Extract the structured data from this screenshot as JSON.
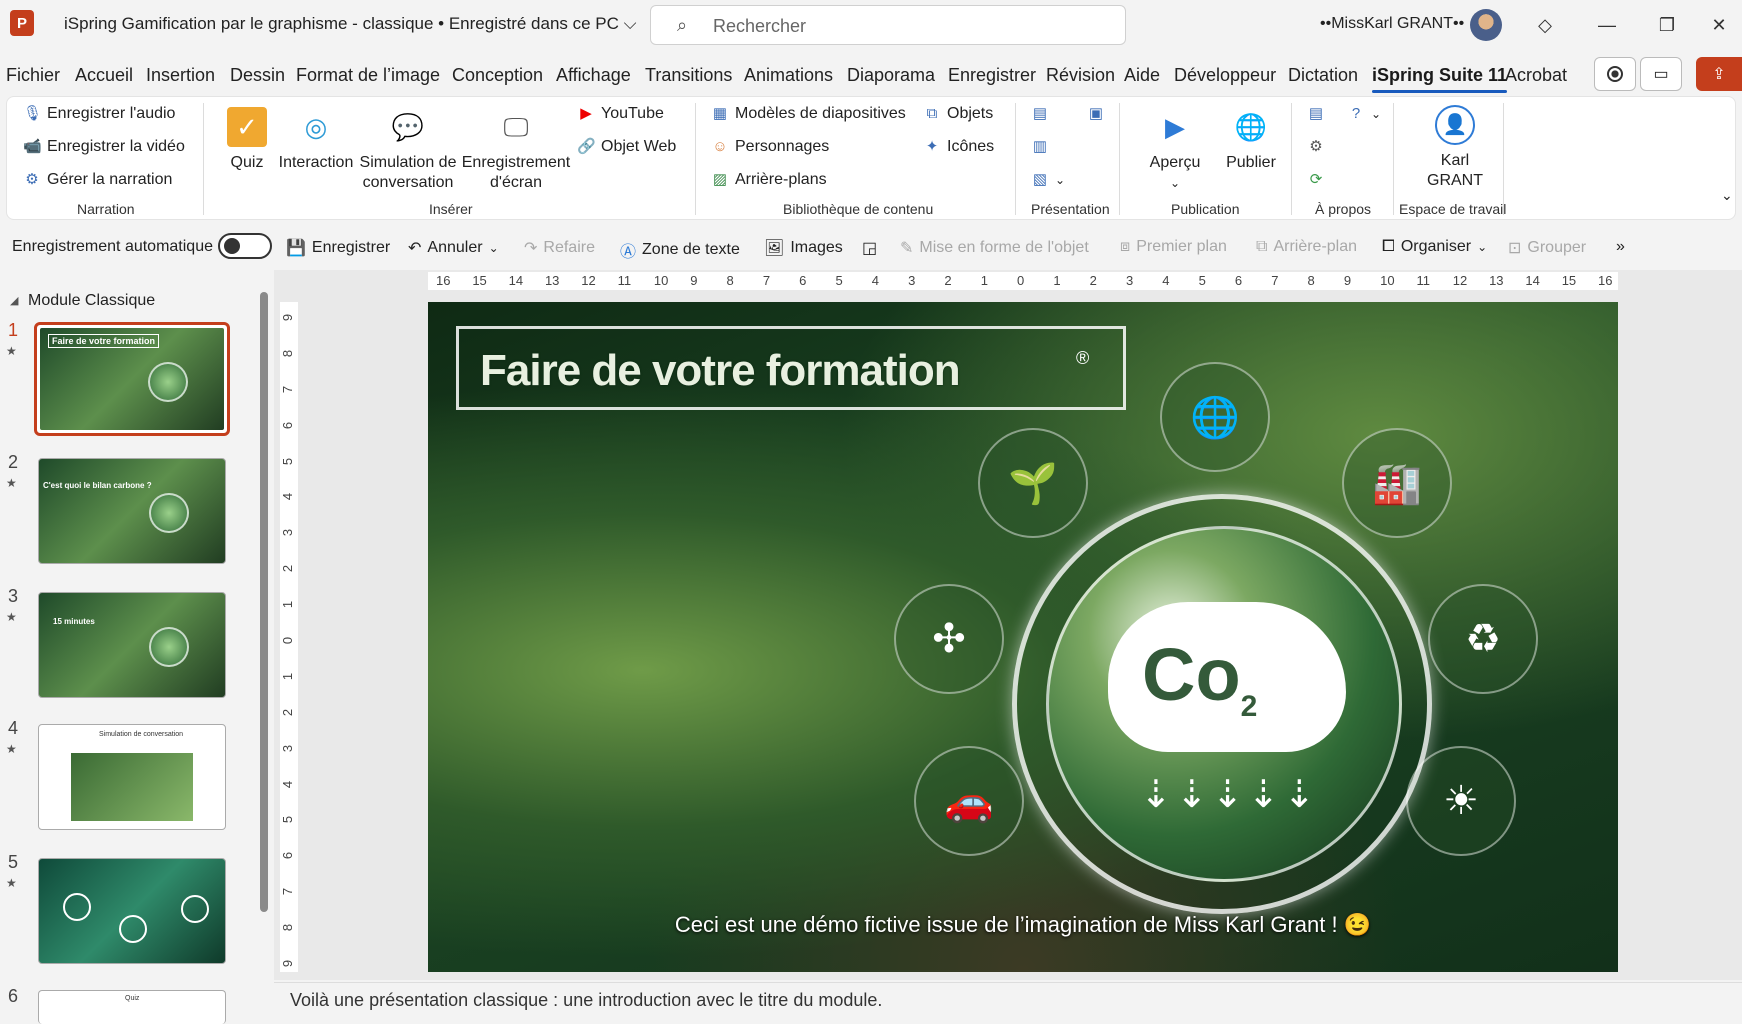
{
  "app": {
    "doc_title": "iSpring Gamification par le graphisme - classique • Enregistré dans ce PC",
    "logo_letter": "P",
    "search_placeholder": "Rechercher",
    "user_name": "••MissKarl GRANT••"
  },
  "menu": [
    "Fichier",
    "Accueil",
    "Insertion",
    "Dessin",
    "Format de l’image",
    "Conception",
    "Affichage",
    "Transitions",
    "Animations",
    "Diaporama",
    "Enregistrer",
    "Révision",
    "Aide",
    "Développeur",
    "Dictation",
    "iSpring Suite 11",
    "Acrobat"
  ],
  "active_menu": "iSpring Suite 11",
  "ribbon": {
    "narration": {
      "record_audio": "Enregistrer l'audio",
      "record_video": "Enregistrer la vidéo",
      "manage": "Gérer la narration",
      "label": "Narration"
    },
    "insert": {
      "quiz": "Quiz",
      "interaction": "Interaction",
      "simulation": "Simulation de conversation",
      "screen_rec": "Enregistrement d'écran",
      "youtube": "YouTube",
      "web_object": "Objet Web",
      "label": "Insérer"
    },
    "library": {
      "templates": "Modèles de diapositives",
      "characters": "Personnages",
      "backgrounds": "Arrière-plans",
      "objects": "Objets",
      "icons": "Icônes",
      "label": "Bibliothèque de contenu"
    },
    "presentation": {
      "label": "Présentation"
    },
    "publication": {
      "preview": "Aperçu",
      "publish": "Publier",
      "label": "Publication"
    },
    "about": {
      "label": "À propos"
    },
    "workspace": {
      "user": "Karl GRANT",
      "label": "Espace de travail"
    }
  },
  "quick_access": {
    "autosave": "Enregistrement automatique",
    "save": "Enregistrer",
    "undo": "Annuler",
    "redo": "Refaire",
    "textbox": "Zone de texte",
    "images": "Images",
    "format_object": "Mise en forme de l'objet",
    "bring_front": "Premier plan",
    "send_back": "Arrière-plan",
    "arrange": "Organiser",
    "group": "Grouper"
  },
  "slides_panel": {
    "module_title": "Module Classique",
    "slides": [
      {
        "num": "1",
        "label": "Faire de votre formation"
      },
      {
        "num": "2",
        "label": "C'est quoi le bilan carbone ?"
      },
      {
        "num": "3",
        "label": "15 minutes"
      },
      {
        "num": "4",
        "label": "Simulation de conversation"
      },
      {
        "num": "5",
        "label": ""
      },
      {
        "num": "6",
        "label": "Quiz"
      }
    ]
  },
  "ruler": {
    "h": [
      "16",
      "15",
      "14",
      "13",
      "12",
      "11",
      "10",
      "9",
      "8",
      "7",
      "6",
      "5",
      "4",
      "3",
      "2",
      "1",
      "0",
      "1",
      "2",
      "3",
      "4",
      "5",
      "6",
      "7",
      "8",
      "9",
      "10",
      "11",
      "12",
      "13",
      "14",
      "15",
      "16"
    ],
    "v": [
      "9",
      "8",
      "7",
      "6",
      "5",
      "4",
      "3",
      "2",
      "1",
      "0",
      "1",
      "2",
      "3",
      "4",
      "5",
      "6",
      "7",
      "8",
      "9"
    ]
  },
  "slide": {
    "title": "Faire de votre formation",
    "co2_main": "Co",
    "co2_sub": "2",
    "caption": "Ceci est une démo fictive issue de l’imagination de Miss Karl Grant ! 😉"
  },
  "notes": "Voilà une présentation classique : une introduction avec le titre du module.",
  "colors": {
    "accent": "#c43e1c",
    "ribbon_accent": "#185abd"
  }
}
